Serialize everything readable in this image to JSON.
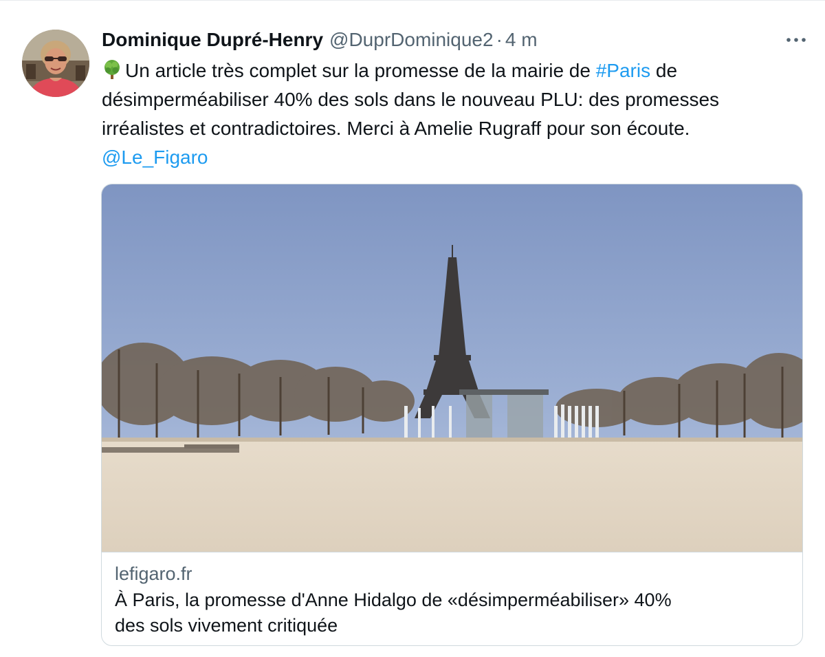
{
  "tweet": {
    "author": {
      "display_name": "Dominique Dupré-Henry",
      "handle": "@DuprDominique2"
    },
    "separator": "·",
    "time": "4 m",
    "emoji_icon": "deciduous-tree-icon",
    "text": {
      "line1_before_link": "Un article très complet sur la promesse de la mairie de ",
      "hashtag": "#Paris",
      "line1_after_link": " de",
      "line2": "désimperméabiliser 40% des sols dans le nouveau PLU: des promesses",
      "line3": "irréalistes et contradictoires. Merci à Amelie Rugraff pour son écoute.",
      "mention": "@Le_Figaro"
    },
    "card": {
      "domain": "lefigaro.fr",
      "title_line1": "À Paris, la promesse d'Anne Hidalgo de «désimperméabiliser» 40%",
      "title_line2": "des sols vivement critiquée"
    }
  },
  "colors": {
    "text": "#0f1419",
    "secondary": "#536471",
    "link": "#1d9bf0",
    "border": "#cfd9de"
  }
}
